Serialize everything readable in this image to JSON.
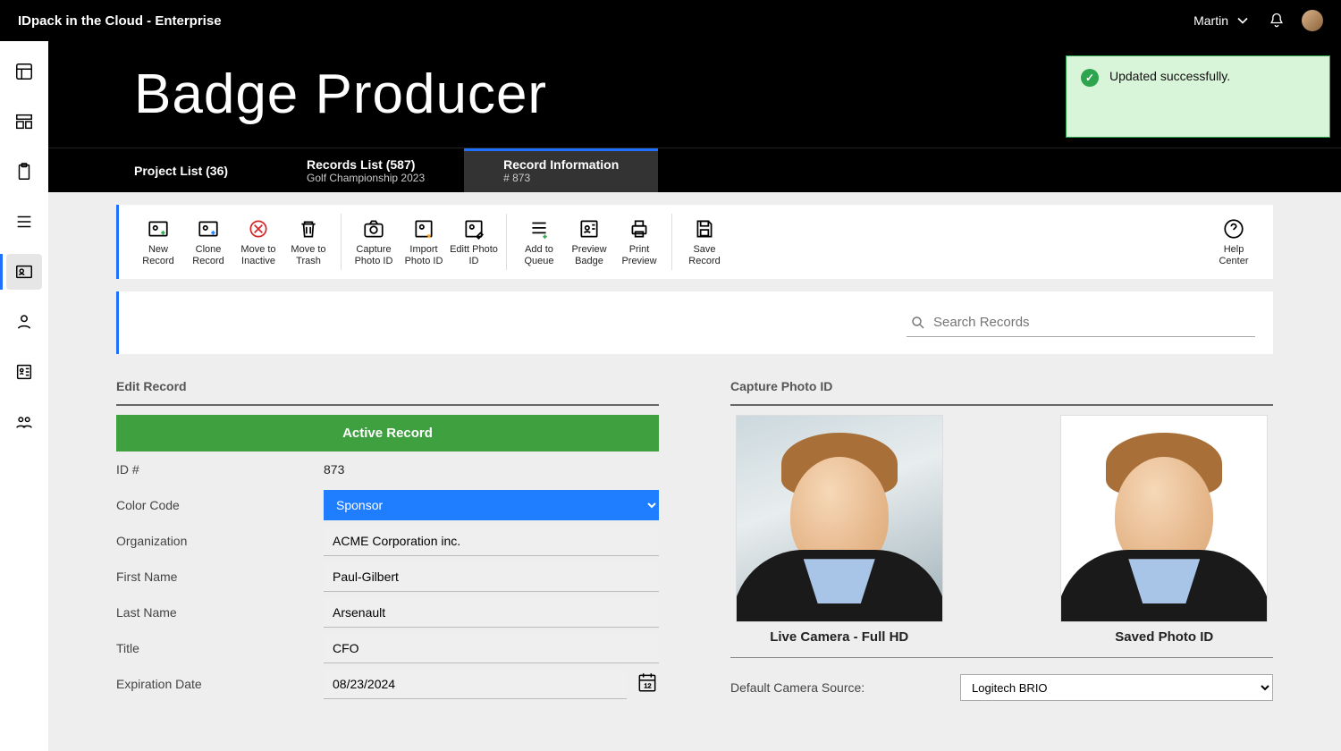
{
  "app_title": "IDpack in the Cloud - Enterprise",
  "user": {
    "name": "Martin"
  },
  "toast": {
    "message": "Updated successfully."
  },
  "page_heading": "Badge Producer",
  "tabs": [
    {
      "title": "Project List (36)",
      "sub": ""
    },
    {
      "title": "Records List (587)",
      "sub": "Golf Championship 2023"
    },
    {
      "title": "Record Information",
      "sub": "# 873"
    }
  ],
  "toolbar": {
    "groups": [
      [
        "New Record",
        "Clone Record",
        "Move to Inactive",
        "Move to Trash"
      ],
      [
        "Capture Photo ID",
        "Import Photo ID",
        "Editt Photo ID"
      ],
      [
        "Add to Queue",
        "Preview Badge",
        "Print Preview"
      ],
      [
        "Save Record"
      ]
    ],
    "help": "Help Center"
  },
  "search": {
    "placeholder": "Search Records"
  },
  "edit_section": {
    "title": "Edit Record",
    "status": "Active Record",
    "id_label": "ID #",
    "id_value": "873",
    "color_label": "Color Code",
    "color_value": "Sponsor",
    "org_label": "Organization",
    "org_value": "ACME Corporation inc.",
    "first_label": "First Name",
    "first_value": "Paul-Gilbert",
    "last_label": "Last Name",
    "last_value": "Arsenault",
    "title_label": "Title",
    "title_value": "CFO",
    "exp_label": "Expiration Date",
    "exp_value": "08/23/2024"
  },
  "photo_section": {
    "title": "Capture Photo ID",
    "live_label": "Live Camera - Full HD",
    "saved_label": "Saved Photo ID",
    "cam_source_label": "Default Camera Source:",
    "cam_source_value": "Logitech BRIO"
  }
}
